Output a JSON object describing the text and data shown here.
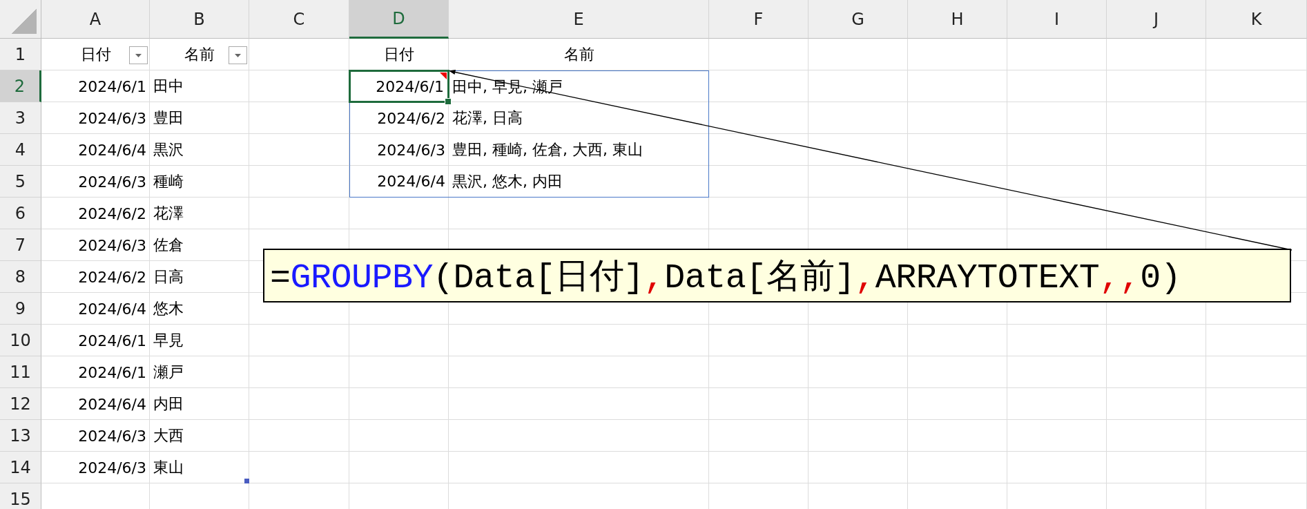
{
  "columns": [
    {
      "label": "A",
      "selected": false
    },
    {
      "label": "B",
      "selected": false
    },
    {
      "label": "C",
      "selected": false
    },
    {
      "label": "D",
      "selected": true
    },
    {
      "label": "E",
      "selected": false
    },
    {
      "label": "F",
      "selected": false
    },
    {
      "label": "G",
      "selected": false
    },
    {
      "label": "H",
      "selected": false
    },
    {
      "label": "I",
      "selected": false
    },
    {
      "label": "J",
      "selected": false
    },
    {
      "label": "K",
      "selected": false
    }
  ],
  "rows": [
    {
      "label": "1",
      "selected": false,
      "cells": [
        {
          "kind": "header",
          "text": "日付",
          "filter_button": true
        },
        {
          "kind": "header",
          "text": "名前",
          "filter_button": true
        },
        {
          "kind": "empty"
        },
        {
          "kind": "header",
          "text": "日付",
          "filter_button": false
        },
        {
          "kind": "header",
          "text": "名前",
          "filter_button": false
        }
      ]
    },
    {
      "label": "2",
      "selected": true,
      "cells": [
        {
          "kind": "date",
          "text": "2024/6/1"
        },
        {
          "kind": "text",
          "text": "田中"
        },
        {
          "kind": "empty"
        },
        {
          "kind": "date",
          "text": "2024/6/1",
          "spill": true,
          "comment": true
        },
        {
          "kind": "text",
          "text": "田中, 早見, 瀬戸",
          "spill": true
        }
      ]
    },
    {
      "label": "3",
      "selected": false,
      "cells": [
        {
          "kind": "date",
          "text": "2024/6/3"
        },
        {
          "kind": "text",
          "text": "豊田"
        },
        {
          "kind": "empty"
        },
        {
          "kind": "date",
          "text": "2024/6/2",
          "spill": true
        },
        {
          "kind": "text",
          "text": "花澤, 日高",
          "spill": true
        }
      ]
    },
    {
      "label": "4",
      "selected": false,
      "cells": [
        {
          "kind": "date",
          "text": "2024/6/4"
        },
        {
          "kind": "text",
          "text": "黒沢"
        },
        {
          "kind": "empty"
        },
        {
          "kind": "date",
          "text": "2024/6/3",
          "spill": true
        },
        {
          "kind": "text",
          "text": "豊田, 種崎, 佐倉, 大西, 東山",
          "spill": true
        }
      ]
    },
    {
      "label": "5",
      "selected": false,
      "cells": [
        {
          "kind": "date",
          "text": "2024/6/3"
        },
        {
          "kind": "text",
          "text": "種崎"
        },
        {
          "kind": "empty"
        },
        {
          "kind": "date",
          "text": "2024/6/4",
          "spill": true
        },
        {
          "kind": "text",
          "text": "黒沢, 悠木, 内田",
          "spill": true
        }
      ]
    },
    {
      "label": "6",
      "selected": false,
      "cells": [
        {
          "kind": "date",
          "text": "2024/6/2"
        },
        {
          "kind": "text",
          "text": "花澤"
        }
      ]
    },
    {
      "label": "7",
      "selected": false,
      "cells": [
        {
          "kind": "date",
          "text": "2024/6/3"
        },
        {
          "kind": "text",
          "text": "佐倉"
        }
      ]
    },
    {
      "label": "8",
      "selected": false,
      "cells": [
        {
          "kind": "date",
          "text": "2024/6/2"
        },
        {
          "kind": "text",
          "text": "日高"
        }
      ]
    },
    {
      "label": "9",
      "selected": false,
      "cells": [
        {
          "kind": "date",
          "text": "2024/6/4"
        },
        {
          "kind": "text",
          "text": "悠木"
        }
      ]
    },
    {
      "label": "10",
      "selected": false,
      "cells": [
        {
          "kind": "date",
          "text": "2024/6/1"
        },
        {
          "kind": "text",
          "text": "早見"
        }
      ]
    },
    {
      "label": "11",
      "selected": false,
      "cells": [
        {
          "kind": "date",
          "text": "2024/6/1"
        },
        {
          "kind": "text",
          "text": "瀬戸"
        }
      ]
    },
    {
      "label": "12",
      "selected": false,
      "cells": [
        {
          "kind": "date",
          "text": "2024/6/4"
        },
        {
          "kind": "text",
          "text": "内田"
        }
      ]
    },
    {
      "label": "13",
      "selected": false,
      "cells": [
        {
          "kind": "date",
          "text": "2024/6/3"
        },
        {
          "kind": "text",
          "text": "大西"
        }
      ]
    },
    {
      "label": "14",
      "selected": false,
      "cells": [
        {
          "kind": "date",
          "text": "2024/6/3"
        },
        {
          "kind": "text",
          "text": "東山",
          "table_resize_handle": true
        }
      ]
    },
    {
      "label": "15",
      "selected": false,
      "cells": []
    }
  ],
  "callout": {
    "formula": [
      {
        "kind": "operator",
        "text": "="
      },
      {
        "kind": "function",
        "text": "GROUPBY"
      },
      {
        "kind": "plain",
        "text": "(Data[日付]"
      },
      {
        "kind": "separator",
        "text": ","
      },
      {
        "kind": "plain",
        "text": "Data[名前]"
      },
      {
        "kind": "separator",
        "text": ","
      },
      {
        "kind": "plain",
        "text": "ARRAYTOTEXT"
      },
      {
        "kind": "separator",
        "text": ","
      },
      {
        "kind": "separator",
        "text": ","
      },
      {
        "kind": "plain",
        "text": "0)"
      }
    ]
  }
}
